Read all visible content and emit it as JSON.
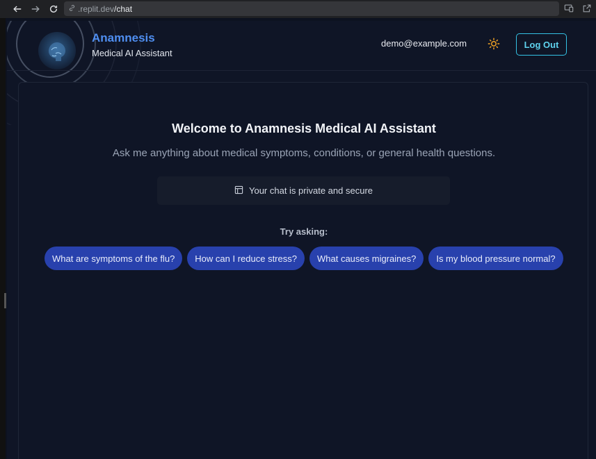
{
  "browser": {
    "url_host": ".replit.dev",
    "url_path": "/chat",
    "icons": [
      "back-arrow-icon",
      "forward-arrow-icon",
      "reload-icon",
      "link-icon",
      "cast-icon",
      "open-external-icon"
    ]
  },
  "header": {
    "title": "Anamnesis",
    "subtitle": "Medical AI Assistant",
    "user_email": "demo@example.com",
    "theme_icon": "sun-icon",
    "logout_label": "Log Out"
  },
  "main": {
    "welcome_title": "Welcome to Anamnesis Medical AI Assistant",
    "welcome_subtitle": "Ask me anything about medical symptoms, conditions, or general health questions.",
    "privacy_icon": "layout-icon",
    "privacy_text": "Your chat is private and secure",
    "try_label": "Try asking:",
    "suggestions": [
      "What are symptoms of the flu?",
      "How can I reduce stress?",
      "What causes migraines?",
      "Is my blood pressure normal?"
    ]
  },
  "colors": {
    "accent_blue": "#4f8ef0",
    "chip_bg": "#2841ad",
    "logout_border": "#34c3e6",
    "sun": "#f5a524",
    "background": "#0f1526"
  }
}
